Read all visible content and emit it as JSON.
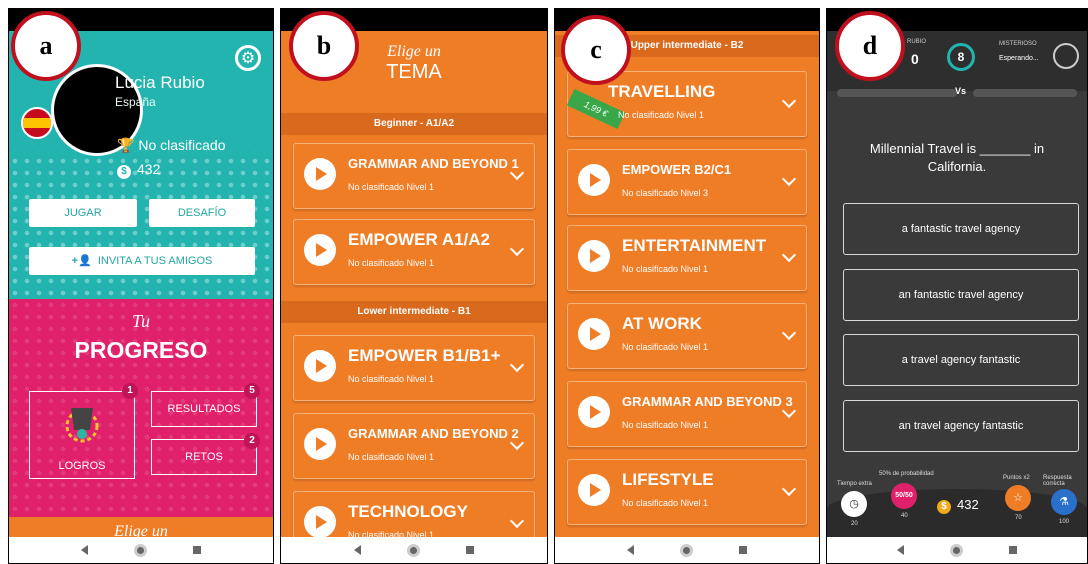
{
  "badges": {
    "a": "a",
    "b": "b",
    "c": "c",
    "d": "d"
  },
  "profile": {
    "name": "Lucia Rubio",
    "country": "España",
    "rank": "No clasificado",
    "coins": "432",
    "play_button": "JUGAR",
    "challenge_button": "DESAFÍO",
    "invite_button": "INVITA A TUS AMIGOS",
    "tu": "Tu",
    "progress_title": "PROGRESO",
    "achievements_label": "LOGROS",
    "achievements_count": "1",
    "results_label": "RESULTADOS",
    "results_count": "5",
    "challenges_label": "RETOS",
    "challenges_count": "2",
    "footer_title": "Elige un"
  },
  "topics_b": {
    "elige": "Elige un",
    "tema": "TEMA",
    "section1": "Beginner - A1/A2",
    "section2": "Lower intermediate - B1",
    "items": [
      {
        "name": "GRAMMAR AND BEYOND 1",
        "meta": "No clasificado   Nivel 1"
      },
      {
        "name": "EMPOWER A1/A2",
        "meta": "No clasificado   Nivel 1"
      },
      {
        "name": "EMPOWER B1/B1+",
        "meta": "No clasificado   Nivel 1"
      },
      {
        "name": "GRAMMAR AND BEYOND 2",
        "meta": "No clasificado   Nivel 1"
      },
      {
        "name": "TECHNOLOGY",
        "meta": "No clasificado   Nivel 1"
      }
    ]
  },
  "topics_c": {
    "section": "Upper intermediate - B2",
    "price": "1,99 €",
    "items": [
      {
        "name": "TRAVELLING",
        "meta": "No clasificado   Nivel 1"
      },
      {
        "name": "EMPOWER B2/C1",
        "meta": "No clasificado   Nivel 3"
      },
      {
        "name": "ENTERTAINMENT",
        "meta": "No clasificado   Nivel 1"
      },
      {
        "name": "AT WORK",
        "meta": "No clasificado   Nivel 1"
      },
      {
        "name": "GRAMMAR AND BEYOND 3",
        "meta": "No clasificado   Nivel 1"
      },
      {
        "name": "LIFESTYLE",
        "meta": "No clasificado   Nivel 1"
      }
    ]
  },
  "quiz": {
    "player_label": "RUBIO",
    "player_score": "0",
    "timer": "8",
    "opponent_label": "MISTERIOSO",
    "opponent_status": "Esperando...",
    "vs": "Vs",
    "question_line1": "Millennial Travel is _______ in",
    "question_line2": "California.",
    "answers": [
      "a fantastic travel agency",
      "an fantastic travel agency",
      "a travel agency fantastic",
      "an travel agency fantastic"
    ],
    "lifeline_time_label": "Tiempo extra",
    "lifeline_time_cost": "20",
    "lifeline_fifty_label": "50% de probabilidad",
    "lifeline_fifty_text": "50/50",
    "lifeline_fifty_cost": "40",
    "coins": "432",
    "lifeline_points_label": "Puntos x2",
    "lifeline_points_cost": "70",
    "lifeline_answer_label": "Respuesta correcta",
    "lifeline_answer_cost": "100"
  }
}
